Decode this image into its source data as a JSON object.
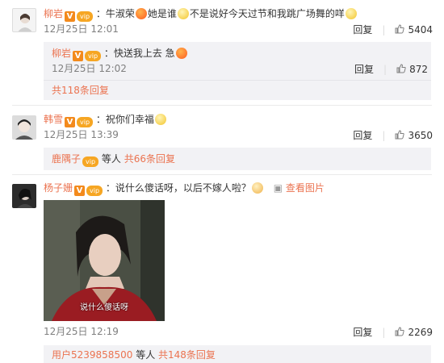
{
  "comments": [
    {
      "user": "柳岩",
      "text_a": "：牛淑荣",
      "text_b": "她是谁",
      "text_c": "不是说好今天过节和我跳广场舞的咩",
      "time": "12月25日 12:01",
      "reply_label": "回复",
      "likes": "5404",
      "subreply": {
        "user": "柳岩",
        "text": "：快送我上去 急",
        "time": "12月25日 12:02",
        "reply_label": "回复",
        "likes": "872"
      },
      "more_replies": "共118条回复"
    },
    {
      "user": "韩雪",
      "text": "：祝你们幸福",
      "time": "12月25日 13:39",
      "reply_label": "回复",
      "likes": "3650",
      "summary_user": "鹿隅子",
      "summary_mid": "等人",
      "summary_count": "共66条回复"
    },
    {
      "user": "杨子姗",
      "text": "：说什么傻话呀，以后不嫁人啦？",
      "view_pic": "查看图片",
      "image_caption": "说什么傻话呀",
      "time": "12月25日 12:19",
      "reply_label": "回复",
      "likes": "2269",
      "summary_user": "用户5239858500",
      "summary_mid": "等人",
      "summary_count": "共148条回复"
    }
  ],
  "badges": {
    "v": "V",
    "vip": "vip"
  },
  "colors": {
    "accent": "#eb7350",
    "time": "#808080",
    "reply_bg": "#f2f2f5"
  }
}
